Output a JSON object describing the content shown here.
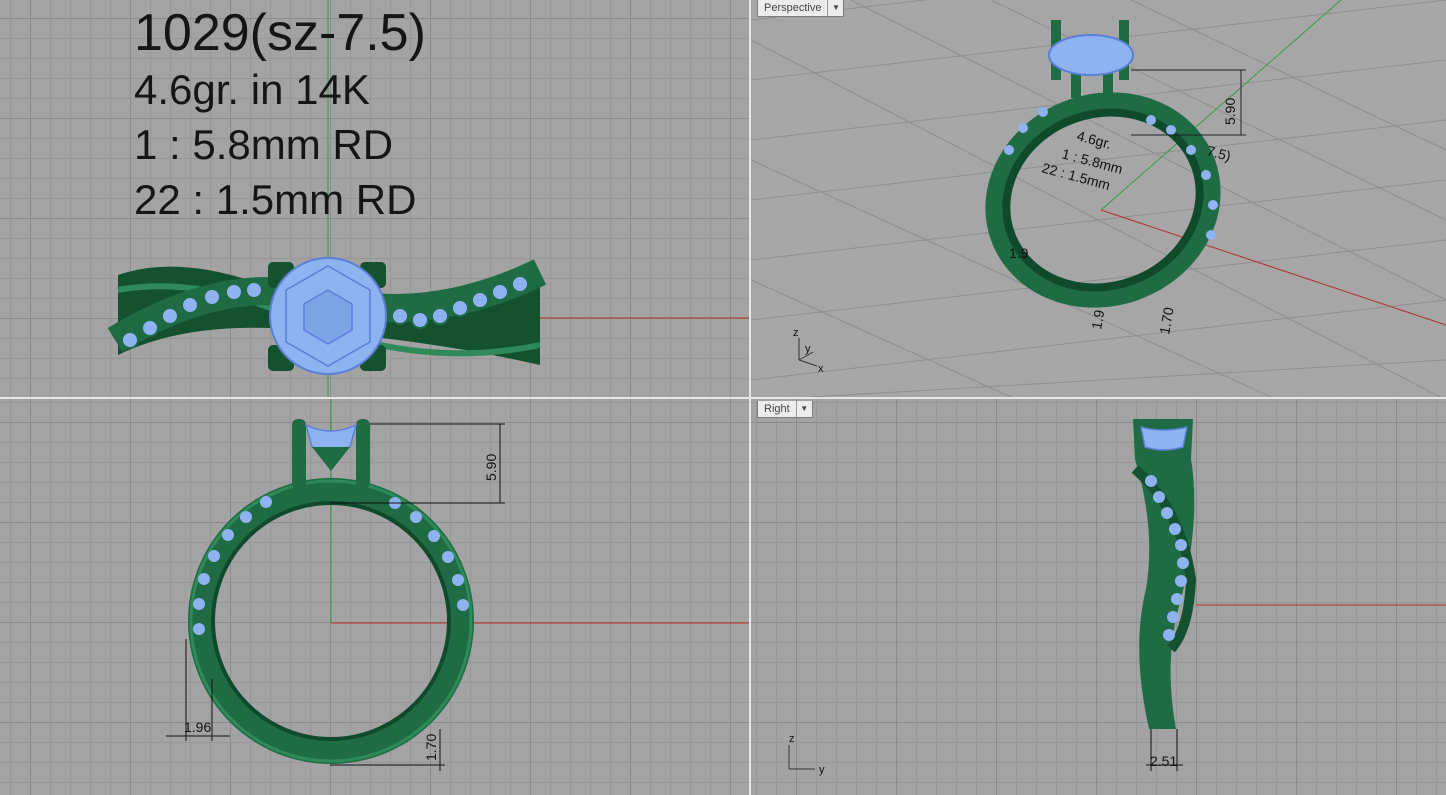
{
  "specs": {
    "model": "1029(sz-7.5)",
    "weight": "4.6gr.  in 14K",
    "center_stone": "1 : 5.8mm RD",
    "side_stones": "22 : 1.5mm RD"
  },
  "viewports": {
    "perspective": {
      "label": "Perspective",
      "persp_text": [
        "4.6gr.",
        "1 : 5.8mm",
        "22 : 1.5mm",
        "7.5)"
      ]
    },
    "right": {
      "label": "Right"
    }
  },
  "dimensions": {
    "front_height": "5.90",
    "front_width": "1.96",
    "front_thickness": "1.70",
    "persp_height": "5.90",
    "persp_thickness": "1.70",
    "persp_width": "1.9",
    "persp_small": "1.9",
    "right_width": "2.51"
  },
  "axes": {
    "x": "x",
    "y": "y",
    "z": "z"
  },
  "colors": {
    "metal": "#1f6b44",
    "metal_dark": "#0f4a2c",
    "stone": "#8fb3f0",
    "stone_line": "#5a7fd6",
    "grid": "#8b8b8b",
    "x_axis": "#b0302a",
    "y_axis": "#2fa03a"
  }
}
